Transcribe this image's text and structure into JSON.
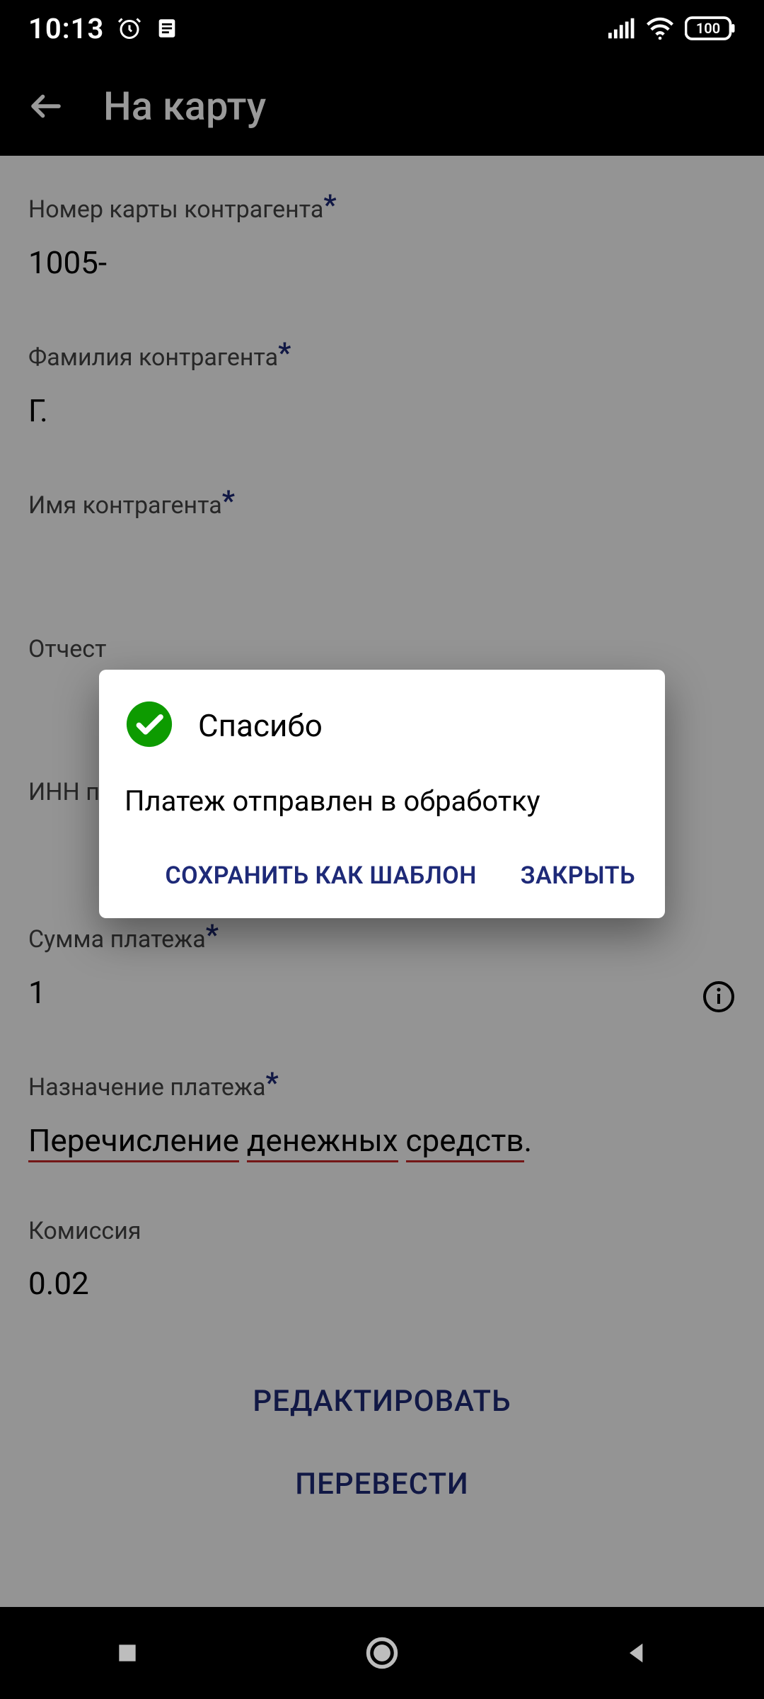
{
  "status": {
    "time": "10:13",
    "battery": "100"
  },
  "header": {
    "title": "На карту"
  },
  "fields": {
    "card_number": {
      "label": "Номер карты контрагента",
      "value": "1005-"
    },
    "surname": {
      "label": "Фамилия контрагента",
      "value": "Г."
    },
    "name": {
      "label": "Имя контрагента",
      "value": ""
    },
    "patronymic": {
      "label": "Отчест",
      "value": ""
    },
    "inn": {
      "label": "ИНН п",
      "value": ""
    },
    "amount": {
      "label": "Сумма платежа",
      "value": "1"
    },
    "purpose": {
      "label": "Назначение платежа",
      "w1": "Перечисление",
      "w2": "денежных",
      "w3": "средств",
      "tail": "."
    },
    "commission": {
      "label": "Комиссия",
      "value": "0.02"
    }
  },
  "actions": {
    "edit": "РЕДАКТИРОВАТЬ",
    "transfer": "ПЕРЕВЕСТИ"
  },
  "dialog": {
    "title": "Спасибо",
    "message": "Платеж отправлен в обработку",
    "save_template": "СОХРАНИТЬ КАК ШАБЛОН",
    "close": "ЗАКРЫТЬ"
  }
}
